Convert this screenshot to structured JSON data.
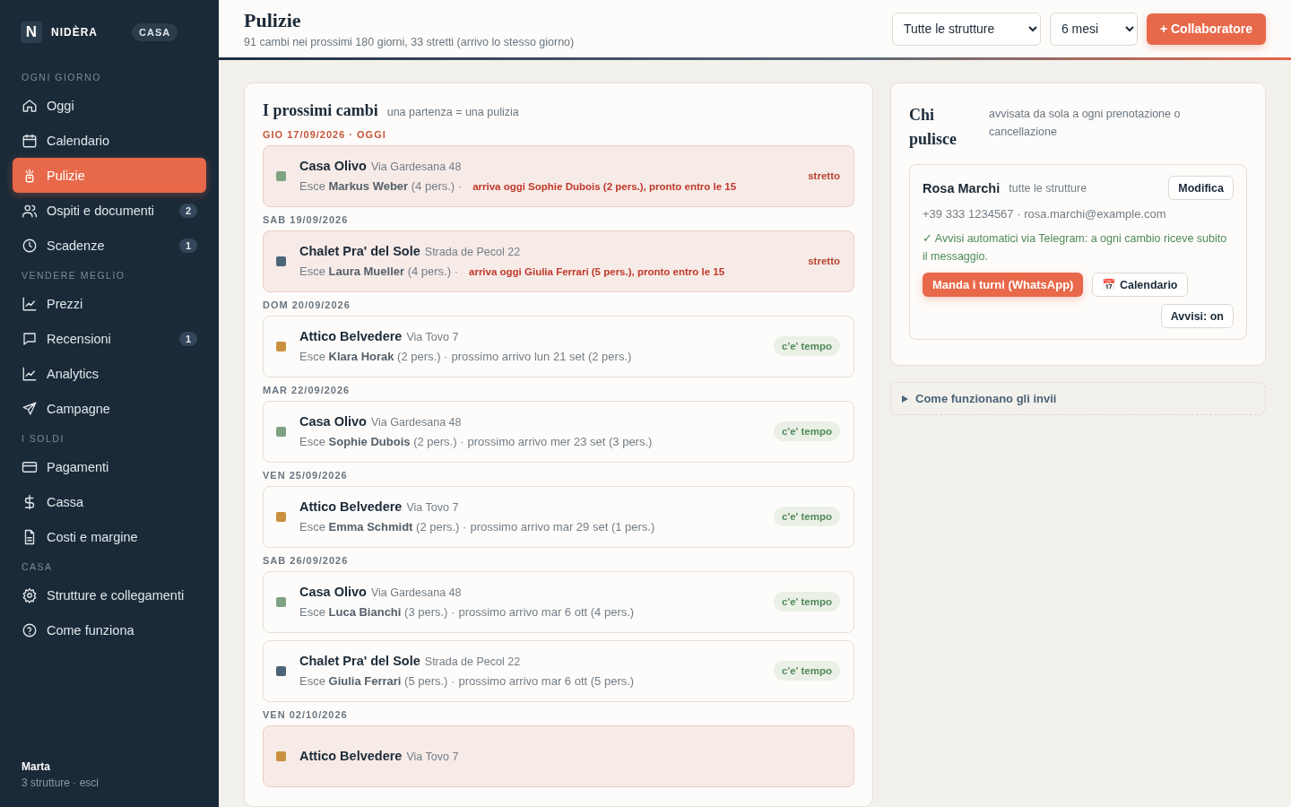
{
  "brand": {
    "logo": "N",
    "name": "NIDÈRA",
    "badge": "CASA"
  },
  "sidebar": {
    "sections": [
      {
        "title": "OGNI GIORNO",
        "items": [
          {
            "label": "Oggi",
            "selected": false
          },
          {
            "label": "Calendario",
            "selected": false
          },
          {
            "label": "Pulizie",
            "selected": true
          },
          {
            "label": "Ospiti e documenti",
            "selected": false,
            "badge": "2"
          },
          {
            "label": "Scadenze",
            "selected": false,
            "badge": "1"
          }
        ]
      },
      {
        "title": "VENDERE MEGLIO",
        "items": [
          {
            "label": "Prezzi",
            "selected": false
          },
          {
            "label": "Recensioni",
            "selected": false,
            "badge": "1"
          },
          {
            "label": "Analytics",
            "selected": false
          },
          {
            "label": "Campagne",
            "selected": false
          }
        ]
      },
      {
        "title": "I SOLDI",
        "items": [
          {
            "label": "Pagamenti",
            "selected": false
          },
          {
            "label": "Cassa",
            "selected": false
          },
          {
            "label": "Costi e margine",
            "selected": false
          }
        ]
      },
      {
        "title": "CASA",
        "items": [
          {
            "label": "Strutture e collegamenti",
            "selected": false
          },
          {
            "label": "Come funziona",
            "selected": false
          }
        ]
      }
    ],
    "user": {
      "name": "Marta",
      "meta": "3 strutture · esci"
    }
  },
  "header": {
    "title": "Pulizie",
    "subtitle": "91 cambi nei prossimi 180 giorni, 33 stretti (arrivo lo stesso giorno)",
    "filters": [
      "Tutte le strutture",
      "6 mesi"
    ],
    "action": "+ Collaboratore"
  },
  "changes": {
    "title": "I prossimi cambi",
    "hint": "una partenza = una pulizia",
    "days": [
      {
        "date": "GIO 17/09/2026 · OGGI",
        "today": true,
        "items": [
          {
            "name": "Casa Olivo",
            "address": "Via Gardesana 48",
            "color": "#7fa283",
            "exit": "Esce **Markus Weber** (4 pers.) ·",
            "next": "arriva oggi Sophie Dubois (2 pers.), pronto entro le 15",
            "tight": true,
            "status": "stretto"
          }
        ]
      },
      {
        "date": "SAB 19/09/2026",
        "today": false,
        "items": [
          {
            "name": "Chalet Pra' del Sole",
            "address": "Strada de Pecol 22",
            "color": "#4b6478",
            "exit": "Esce **Laura Mueller** (4 pers.) ·",
            "next": "arriva oggi Giulia Ferrari (5 pers.), pronto entro le 15",
            "tight": true,
            "status": "stretto"
          }
        ]
      },
      {
        "date": "DOM 20/09/2026",
        "today": false,
        "items": [
          {
            "name": "Attico Belvedere",
            "address": "Via Tovo 7",
            "color": "#c9913f",
            "exit": "Esce **Klara Horak** (2 pers.) ·",
            "next": "prossimo arrivo lun 21 set (2 pers.)",
            "tight": false,
            "status": "c'e' tempo"
          }
        ]
      },
      {
        "date": "MAR 22/09/2026",
        "today": false,
        "items": [
          {
            "name": "Casa Olivo",
            "address": "Via Gardesana 48",
            "color": "#7fa283",
            "exit": "Esce **Sophie Dubois** (2 pers.) ·",
            "next": "prossimo arrivo mer 23 set (3 pers.)",
            "tight": false,
            "status": "c'e' tempo"
          }
        ]
      },
      {
        "date": "VEN 25/09/2026",
        "today": false,
        "items": [
          {
            "name": "Attico Belvedere",
            "address": "Via Tovo 7",
            "color": "#c9913f",
            "exit": "Esce **Emma Schmidt** (2 pers.) ·",
            "next": "prossimo arrivo mar 29 set (1 pers.)",
            "tight": false,
            "status": "c'e' tempo"
          }
        ]
      },
      {
        "date": "SAB 26/09/2026",
        "today": false,
        "items": [
          {
            "name": "Casa Olivo",
            "address": "Via Gardesana 48",
            "color": "#7fa283",
            "exit": "Esce **Luca Bianchi** (3 pers.) ·",
            "next": "prossimo arrivo mar 6 ott (4 pers.)",
            "tight": false,
            "status": "c'e' tempo"
          },
          {
            "name": "Chalet Pra' del Sole",
            "address": "Strada de Pecol 22",
            "color": "#4b6478",
            "exit": "Esce **Giulia Ferrari** (5 pers.) ·",
            "next": "prossimo arrivo mar 6 ott (5 pers.)",
            "tight": false,
            "status": "c'e' tempo"
          }
        ]
      },
      {
        "date": "VEN 02/10/2026",
        "today": false,
        "items": [
          {
            "name": "Attico Belvedere",
            "address": "Via Tovo 7",
            "color": "#c9913f",
            "tight": true
          }
        ]
      }
    ]
  },
  "cleaners": {
    "title": "Chi pulisce",
    "hint": "avvisata da sola a ogni prenotazione o cancellazione",
    "people": [
      {
        "name": "Rosa Marchi",
        "scope": "tutte le strutture",
        "edit": "Modifica",
        "contact": "+39 333 1234567 · rosa.marchi@example.com",
        "notice": "✓ Avvisi automatici via Telegram: a ogni cambio riceve subito il messaggio.",
        "send": "Manda i turni (WhatsApp)",
        "calendar_icon": "📅",
        "calendar": "Calendario",
        "alerts": "Avvisi: on"
      }
    ]
  },
  "details": {
    "summary": "Come funzionano gli invii",
    "expanded": false
  }
}
